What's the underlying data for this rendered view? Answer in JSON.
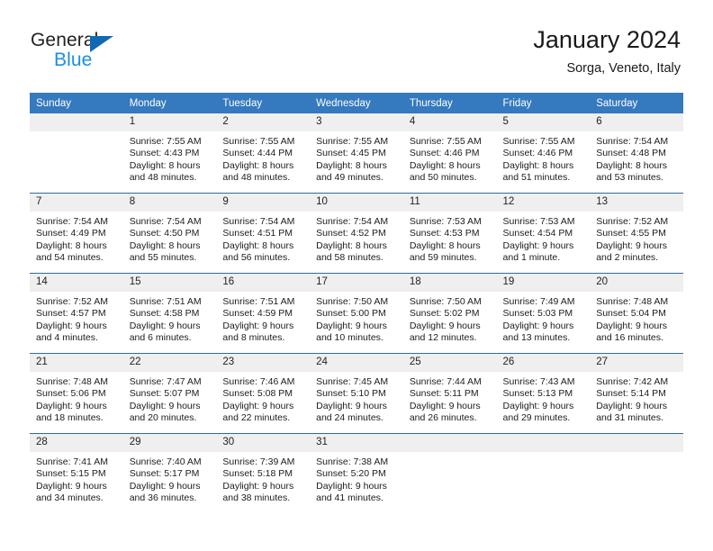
{
  "brand": {
    "name_part1": "General",
    "name_part2": "Blue",
    "triangle_icon": "brand-triangle-icon"
  },
  "header": {
    "title": "January 2024",
    "subtitle": "Sorga, Veneto, Italy"
  },
  "colors": {
    "header_blue": "#3579be",
    "row_divider_blue": "#2b6ca8",
    "daynum_band": "#efefef",
    "brand_dark": "#231f20",
    "brand_blue": "#1a8fe0",
    "brand_triangle": "#1268b3"
  },
  "weekdays": [
    "Sunday",
    "Monday",
    "Tuesday",
    "Wednesday",
    "Thursday",
    "Friday",
    "Saturday"
  ],
  "labels": {
    "sunrise": "Sunrise:",
    "sunset": "Sunset:",
    "daylight": "Daylight:"
  },
  "weeks": [
    [
      {
        "day": "",
        "empty": true,
        "sunrise": "",
        "sunset": "",
        "daylight_line1": "",
        "daylight_line2": ""
      },
      {
        "day": "1",
        "empty": false,
        "sunrise": "Sunrise: 7:55 AM",
        "sunset": "Sunset: 4:43 PM",
        "daylight_line1": "Daylight: 8 hours",
        "daylight_line2": "and 48 minutes."
      },
      {
        "day": "2",
        "empty": false,
        "sunrise": "Sunrise: 7:55 AM",
        "sunset": "Sunset: 4:44 PM",
        "daylight_line1": "Daylight: 8 hours",
        "daylight_line2": "and 48 minutes."
      },
      {
        "day": "3",
        "empty": false,
        "sunrise": "Sunrise: 7:55 AM",
        "sunset": "Sunset: 4:45 PM",
        "daylight_line1": "Daylight: 8 hours",
        "daylight_line2": "and 49 minutes."
      },
      {
        "day": "4",
        "empty": false,
        "sunrise": "Sunrise: 7:55 AM",
        "sunset": "Sunset: 4:46 PM",
        "daylight_line1": "Daylight: 8 hours",
        "daylight_line2": "and 50 minutes."
      },
      {
        "day": "5",
        "empty": false,
        "sunrise": "Sunrise: 7:55 AM",
        "sunset": "Sunset: 4:46 PM",
        "daylight_line1": "Daylight: 8 hours",
        "daylight_line2": "and 51 minutes."
      },
      {
        "day": "6",
        "empty": false,
        "sunrise": "Sunrise: 7:54 AM",
        "sunset": "Sunset: 4:48 PM",
        "daylight_line1": "Daylight: 8 hours",
        "daylight_line2": "and 53 minutes."
      }
    ],
    [
      {
        "day": "7",
        "empty": false,
        "sunrise": "Sunrise: 7:54 AM",
        "sunset": "Sunset: 4:49 PM",
        "daylight_line1": "Daylight: 8 hours",
        "daylight_line2": "and 54 minutes."
      },
      {
        "day": "8",
        "empty": false,
        "sunrise": "Sunrise: 7:54 AM",
        "sunset": "Sunset: 4:50 PM",
        "daylight_line1": "Daylight: 8 hours",
        "daylight_line2": "and 55 minutes."
      },
      {
        "day": "9",
        "empty": false,
        "sunrise": "Sunrise: 7:54 AM",
        "sunset": "Sunset: 4:51 PM",
        "daylight_line1": "Daylight: 8 hours",
        "daylight_line2": "and 56 minutes."
      },
      {
        "day": "10",
        "empty": false,
        "sunrise": "Sunrise: 7:54 AM",
        "sunset": "Sunset: 4:52 PM",
        "daylight_line1": "Daylight: 8 hours",
        "daylight_line2": "and 58 minutes."
      },
      {
        "day": "11",
        "empty": false,
        "sunrise": "Sunrise: 7:53 AM",
        "sunset": "Sunset: 4:53 PM",
        "daylight_line1": "Daylight: 8 hours",
        "daylight_line2": "and 59 minutes."
      },
      {
        "day": "12",
        "empty": false,
        "sunrise": "Sunrise: 7:53 AM",
        "sunset": "Sunset: 4:54 PM",
        "daylight_line1": "Daylight: 9 hours",
        "daylight_line2": "and 1 minute."
      },
      {
        "day": "13",
        "empty": false,
        "sunrise": "Sunrise: 7:52 AM",
        "sunset": "Sunset: 4:55 PM",
        "daylight_line1": "Daylight: 9 hours",
        "daylight_line2": "and 2 minutes."
      }
    ],
    [
      {
        "day": "14",
        "empty": false,
        "sunrise": "Sunrise: 7:52 AM",
        "sunset": "Sunset: 4:57 PM",
        "daylight_line1": "Daylight: 9 hours",
        "daylight_line2": "and 4 minutes."
      },
      {
        "day": "15",
        "empty": false,
        "sunrise": "Sunrise: 7:51 AM",
        "sunset": "Sunset: 4:58 PM",
        "daylight_line1": "Daylight: 9 hours",
        "daylight_line2": "and 6 minutes."
      },
      {
        "day": "16",
        "empty": false,
        "sunrise": "Sunrise: 7:51 AM",
        "sunset": "Sunset: 4:59 PM",
        "daylight_line1": "Daylight: 9 hours",
        "daylight_line2": "and 8 minutes."
      },
      {
        "day": "17",
        "empty": false,
        "sunrise": "Sunrise: 7:50 AM",
        "sunset": "Sunset: 5:00 PM",
        "daylight_line1": "Daylight: 9 hours",
        "daylight_line2": "and 10 minutes."
      },
      {
        "day": "18",
        "empty": false,
        "sunrise": "Sunrise: 7:50 AM",
        "sunset": "Sunset: 5:02 PM",
        "daylight_line1": "Daylight: 9 hours",
        "daylight_line2": "and 12 minutes."
      },
      {
        "day": "19",
        "empty": false,
        "sunrise": "Sunrise: 7:49 AM",
        "sunset": "Sunset: 5:03 PM",
        "daylight_line1": "Daylight: 9 hours",
        "daylight_line2": "and 13 minutes."
      },
      {
        "day": "20",
        "empty": false,
        "sunrise": "Sunrise: 7:48 AM",
        "sunset": "Sunset: 5:04 PM",
        "daylight_line1": "Daylight: 9 hours",
        "daylight_line2": "and 16 minutes."
      }
    ],
    [
      {
        "day": "21",
        "empty": false,
        "sunrise": "Sunrise: 7:48 AM",
        "sunset": "Sunset: 5:06 PM",
        "daylight_line1": "Daylight: 9 hours",
        "daylight_line2": "and 18 minutes."
      },
      {
        "day": "22",
        "empty": false,
        "sunrise": "Sunrise: 7:47 AM",
        "sunset": "Sunset: 5:07 PM",
        "daylight_line1": "Daylight: 9 hours",
        "daylight_line2": "and 20 minutes."
      },
      {
        "day": "23",
        "empty": false,
        "sunrise": "Sunrise: 7:46 AM",
        "sunset": "Sunset: 5:08 PM",
        "daylight_line1": "Daylight: 9 hours",
        "daylight_line2": "and 22 minutes."
      },
      {
        "day": "24",
        "empty": false,
        "sunrise": "Sunrise: 7:45 AM",
        "sunset": "Sunset: 5:10 PM",
        "daylight_line1": "Daylight: 9 hours",
        "daylight_line2": "and 24 minutes."
      },
      {
        "day": "25",
        "empty": false,
        "sunrise": "Sunrise: 7:44 AM",
        "sunset": "Sunset: 5:11 PM",
        "daylight_line1": "Daylight: 9 hours",
        "daylight_line2": "and 26 minutes."
      },
      {
        "day": "26",
        "empty": false,
        "sunrise": "Sunrise: 7:43 AM",
        "sunset": "Sunset: 5:13 PM",
        "daylight_line1": "Daylight: 9 hours",
        "daylight_line2": "and 29 minutes."
      },
      {
        "day": "27",
        "empty": false,
        "sunrise": "Sunrise: 7:42 AM",
        "sunset": "Sunset: 5:14 PM",
        "daylight_line1": "Daylight: 9 hours",
        "daylight_line2": "and 31 minutes."
      }
    ],
    [
      {
        "day": "28",
        "empty": false,
        "sunrise": "Sunrise: 7:41 AM",
        "sunset": "Sunset: 5:15 PM",
        "daylight_line1": "Daylight: 9 hours",
        "daylight_line2": "and 34 minutes."
      },
      {
        "day": "29",
        "empty": false,
        "sunrise": "Sunrise: 7:40 AM",
        "sunset": "Sunset: 5:17 PM",
        "daylight_line1": "Daylight: 9 hours",
        "daylight_line2": "and 36 minutes."
      },
      {
        "day": "30",
        "empty": false,
        "sunrise": "Sunrise: 7:39 AM",
        "sunset": "Sunset: 5:18 PM",
        "daylight_line1": "Daylight: 9 hours",
        "daylight_line2": "and 38 minutes."
      },
      {
        "day": "31",
        "empty": false,
        "sunrise": "Sunrise: 7:38 AM",
        "sunset": "Sunset: 5:20 PM",
        "daylight_line1": "Daylight: 9 hours",
        "daylight_line2": "and 41 minutes."
      },
      {
        "day": "",
        "empty": true,
        "sunrise": "",
        "sunset": "",
        "daylight_line1": "",
        "daylight_line2": ""
      },
      {
        "day": "",
        "empty": true,
        "sunrise": "",
        "sunset": "",
        "daylight_line1": "",
        "daylight_line2": ""
      },
      {
        "day": "",
        "empty": true,
        "sunrise": "",
        "sunset": "",
        "daylight_line1": "",
        "daylight_line2": ""
      }
    ]
  ]
}
